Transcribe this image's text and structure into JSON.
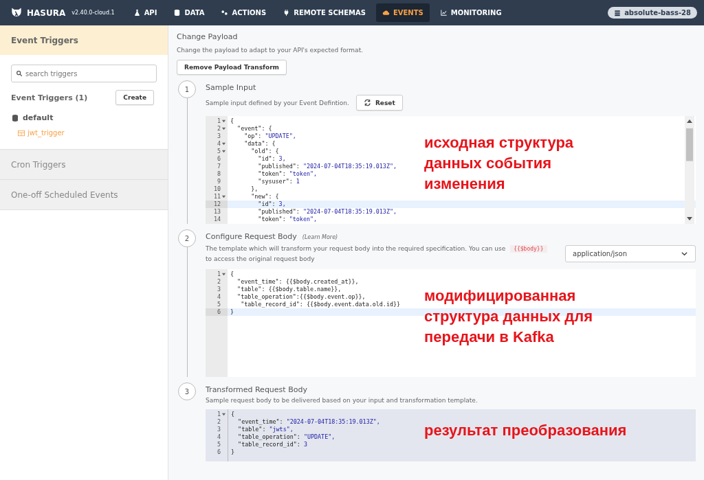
{
  "brand": {
    "name": "HASURA",
    "version": "v2.40.0-cloud.1"
  },
  "nav": [
    {
      "label": "API",
      "selected": false
    },
    {
      "label": "DATA",
      "selected": false
    },
    {
      "label": "ACTIONS",
      "selected": false
    },
    {
      "label": "REMOTE SCHEMAS",
      "selected": false
    },
    {
      "label": "EVENTS",
      "selected": true
    },
    {
      "label": "MONITORING",
      "selected": false
    }
  ],
  "project": "absolute-bass-28",
  "sidebar": {
    "sections": [
      {
        "label": "Event Triggers",
        "selected": true
      },
      {
        "label": "Cron Triggers",
        "selected": false
      },
      {
        "label": "One-off Scheduled Events",
        "selected": false
      }
    ],
    "search": {
      "placeholder": "search triggers"
    },
    "heading": "Event Triggers (1)",
    "create": "Create",
    "source": "default",
    "triggers": [
      {
        "label": "jwt_trigger",
        "selected": true
      }
    ]
  },
  "main": {
    "title": "Change Payload",
    "subtitle": "Change the payload to adapt to your API's expected format.",
    "remove_button": "Remove Payload Transform",
    "steps": [
      {
        "number": "1",
        "title": "Sample Input",
        "description": "Sample input defined by your Event Defintion.",
        "button": "Reset",
        "kind": "editable",
        "annotation": "исходная структура данных события изменения",
        "lines": [
          {
            "n": "1",
            "code": "{",
            "fold": true,
            "active": false
          },
          {
            "n": "2",
            "code": "  \"event\": {",
            "fold": true,
            "active": false
          },
          {
            "n": "3",
            "code": "    \"op\": ",
            "value": "\"UPDATE\",",
            "fold": false,
            "active": false
          },
          {
            "n": "4",
            "code": "    \"data\": {",
            "fold": true,
            "active": false
          },
          {
            "n": "5",
            "code": "      \"old\": {",
            "fold": true,
            "active": false
          },
          {
            "n": "6",
            "code": "        \"id\": ",
            "value": "3,",
            "fold": false,
            "active": false
          },
          {
            "n": "7",
            "code": "        \"published\": ",
            "value": "\"2024-07-04T18:35:19.013Z\",",
            "fold": false,
            "active": false
          },
          {
            "n": "8",
            "code": "        \"token\": ",
            "value": "\"token\",",
            "fold": false,
            "active": false
          },
          {
            "n": "9",
            "code": "        \"sysuser\": ",
            "value": "1",
            "fold": false,
            "active": false
          },
          {
            "n": "10",
            "code": "      },",
            "fold": false,
            "active": false
          },
          {
            "n": "11",
            "code": "      \"new\": {",
            "fold": true,
            "active": false
          },
          {
            "n": "12",
            "code": "        \"id\": ",
            "value": "3,",
            "fold": false,
            "active": true
          },
          {
            "n": "13",
            "code": "        \"published\": ",
            "value": "\"2024-07-04T18:35:19.013Z\",",
            "fold": false,
            "active": false
          },
          {
            "n": "14",
            "code": "        \"token\": ",
            "value": "\"token\",",
            "fold": false,
            "active": false
          }
        ]
      },
      {
        "number": "2",
        "title": "Configure Request Body",
        "link": "(Learn More)",
        "description": "The template which will transform your request body into the required specification. You can use",
        "token": "{{$body}}",
        "description_end": "to access the original request body",
        "select": "application/json",
        "kind": "template",
        "annotation": "модифицированная структура данных для передачи в Kafka",
        "lines": [
          {
            "n": "1",
            "code": "{",
            "fold": true,
            "active": false
          },
          {
            "n": "2",
            "code": "  \"event_time\": {{$body.created_at}},",
            "fold": false,
            "active": false
          },
          {
            "n": "3",
            "code": "  \"table\": {{$body.table.name}},",
            "fold": false,
            "active": false
          },
          {
            "n": "4",
            "code": "  \"table_operation\":{{$body.event.op}},",
            "fold": false,
            "active": false
          },
          {
            "n": "5",
            "code": "   \"table_record_id\": {{$body.event.data.old.id}}",
            "fold": false,
            "active": false
          },
          {
            "n": "6",
            "code": "}",
            "fold": false,
            "active": true
          }
        ]
      },
      {
        "number": "3",
        "title": "Transformed Request Body",
        "description": "Sample request body to be delivered based on your input and transformation template.",
        "kind": "readonly",
        "annotation": "результат преобразования",
        "lines": [
          {
            "n": "1",
            "code": "{",
            "fold": true,
            "active": false
          },
          {
            "n": "2",
            "code": "  \"event_time\": ",
            "value": "\"2024-07-04T18:35:19.013Z\",",
            "fold": false,
            "active": false
          },
          {
            "n": "3",
            "code": "  \"table\": ",
            "value": "\"jwts\",",
            "fold": false,
            "active": false
          },
          {
            "n": "4",
            "code": "  \"table_operation\": ",
            "value": "\"UPDATE\",",
            "fold": false,
            "active": false
          },
          {
            "n": "5",
            "code": "  \"table_record_id\": ",
            "value": "3",
            "fold": false,
            "active": false
          },
          {
            "n": "6",
            "code": "}",
            "fold": false,
            "active": false
          }
        ]
      }
    ]
  }
}
